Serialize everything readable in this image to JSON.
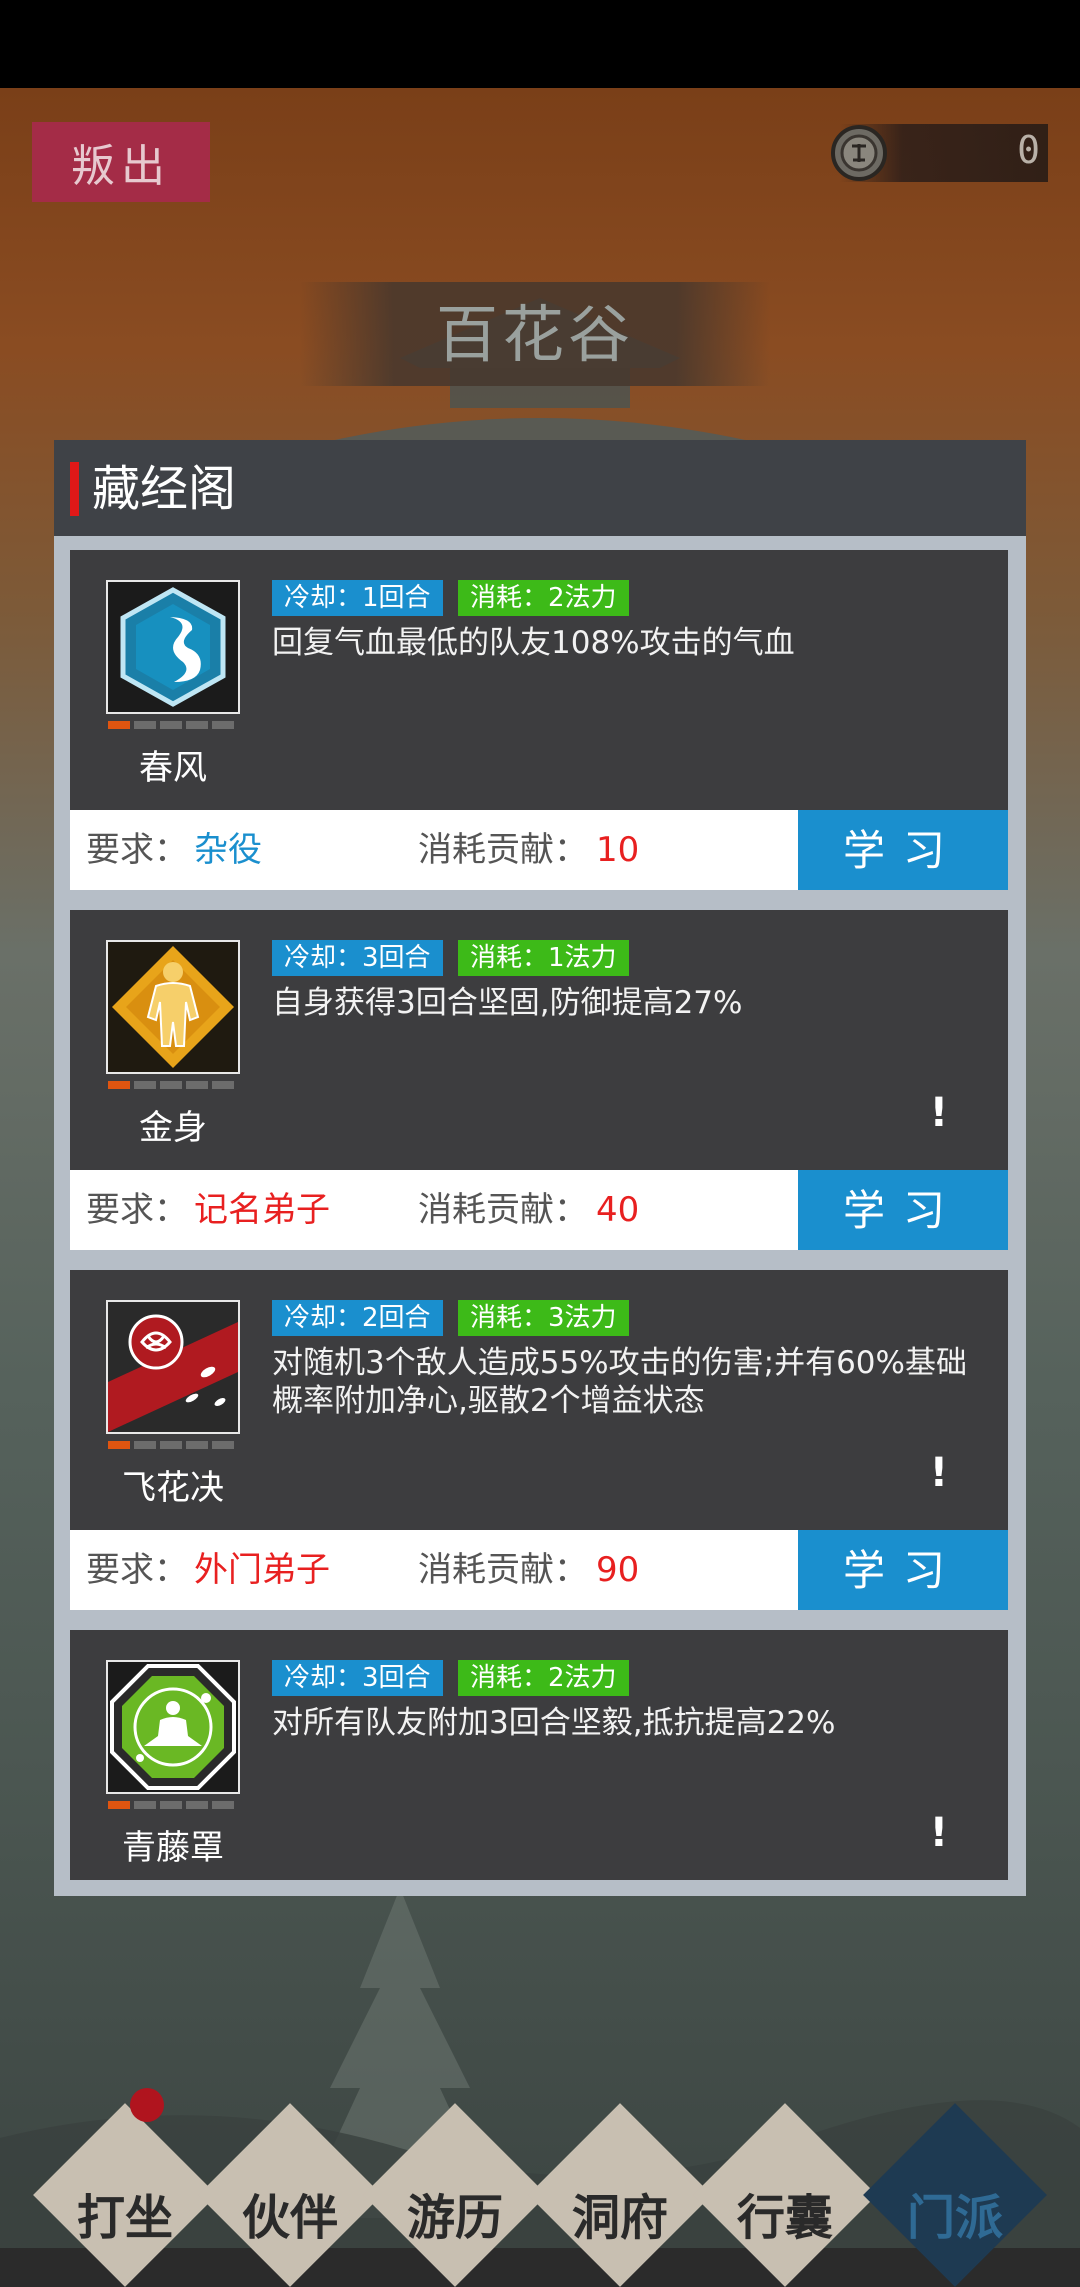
{
  "header": {
    "betray_label": "叛出",
    "currency_value": "0",
    "sect_name": "百花谷"
  },
  "panel": {
    "title": "藏经阁",
    "skills": [
      {
        "name": "春风",
        "cooldown": "冷却：1回合",
        "cost": "消耗：2法力",
        "description": "回复气血最低的队友108%攻击的气血",
        "level": 1,
        "level_max": 5,
        "requirement_label": "要求：",
        "requirement": "杂役",
        "requirement_color": "#1a8fce",
        "contribution_label": "消耗贡献：",
        "contribution": "10",
        "learn_label": "学习",
        "icon": "water-spirit-icon"
      },
      {
        "name": "金身",
        "cooldown": "冷却：3回合",
        "cost": "消耗：1法力",
        "description": "自身获得3回合坚固,防御提高27%",
        "level": 1,
        "level_max": 5,
        "warning": "!",
        "requirement_label": "要求：",
        "requirement": "记名弟子",
        "requirement_color": "#e82020",
        "contribution_label": "消耗贡献：",
        "contribution": "40",
        "learn_label": "学习",
        "icon": "golden-body-icon"
      },
      {
        "name": "飞花决",
        "cooldown": "冷却：2回合",
        "cost": "消耗：3法力",
        "description": "对随机3个敌人造成55%攻击的伤害;并有60%基础概率附加净心,驱散2个增益状态",
        "level": 1,
        "level_max": 5,
        "warning": "!",
        "requirement_label": "要求：",
        "requirement": "外门弟子",
        "requirement_color": "#e82020",
        "contribution_label": "消耗贡献：",
        "contribution": "90",
        "learn_label": "学习",
        "icon": "flying-flower-icon"
      },
      {
        "name": "青藤罩",
        "cooldown": "冷却：3回合",
        "cost": "消耗：2法力",
        "description": "对所有队友附加3回合坚毅,抵抗提高22%",
        "level": 1,
        "level_max": 5,
        "warning": "!",
        "icon": "meditation-icon"
      }
    ]
  },
  "nav": {
    "items": [
      "打坐",
      "伙伴",
      "游历",
      "洞府",
      "行囊",
      "门派"
    ],
    "active": "门派"
  }
}
